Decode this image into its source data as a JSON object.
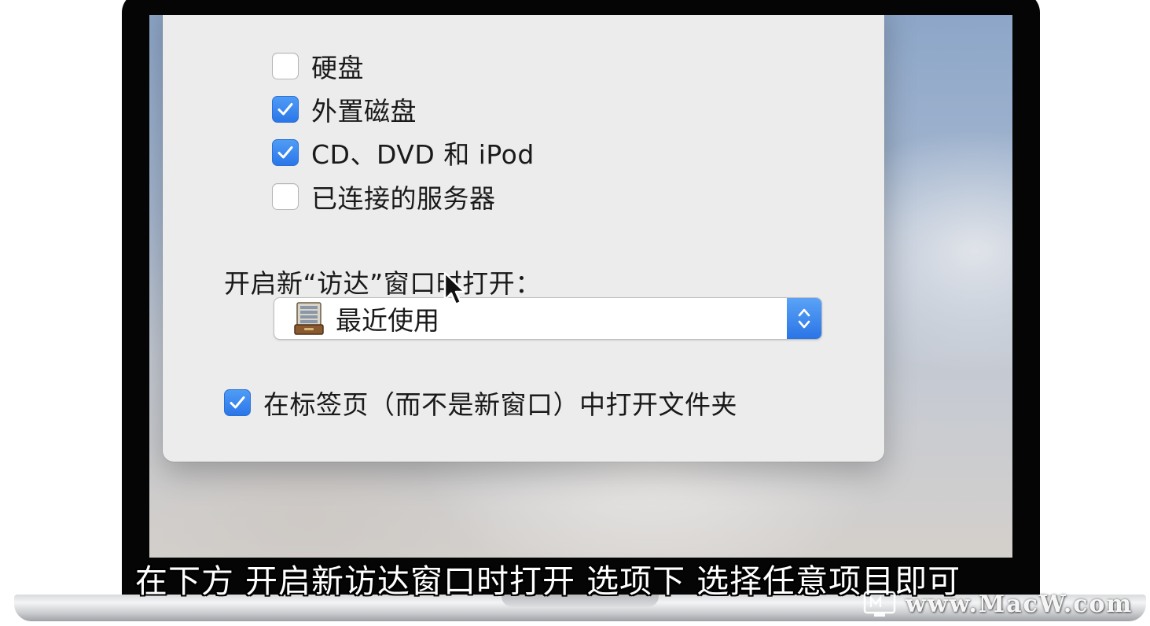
{
  "sidebar_items": [
    {
      "label": "硬盘",
      "checked": false
    },
    {
      "label": "外置磁盘",
      "checked": true
    },
    {
      "label": "CD、DVD 和 iPod",
      "checked": true
    },
    {
      "label": "已连接的服务器",
      "checked": false
    }
  ],
  "new_window": {
    "title": "开启新“访达”窗口时打开：",
    "selected": "最近使用",
    "icon": "recents-cabinet-icon"
  },
  "tabs_option": {
    "label": "在标签页（而不是新窗口）中打开文件夹",
    "checked": true
  },
  "subtitle": "在下方 开启新访达窗口时打开 选项下 选择任意项目即可",
  "watermark": "www.MacW.com",
  "colors": {
    "accent": "#2b76e8",
    "panel": "#ececec",
    "bezel": "#050505"
  }
}
